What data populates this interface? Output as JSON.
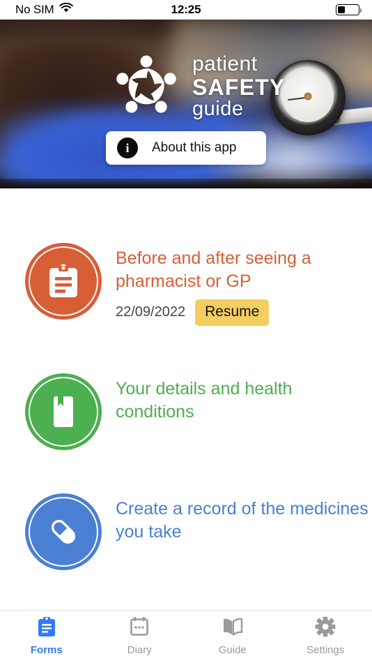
{
  "status_bar": {
    "carrier": "No SIM",
    "wifi_icon": "wifi-icon",
    "time": "12:25",
    "battery_icon": "battery-low-icon",
    "battery_level_pct": 35
  },
  "hero": {
    "logo": {
      "mark_icon": "patient-safety-circle-people-logo",
      "line1": "patient",
      "line2": "SAFETY",
      "line3": "guide"
    },
    "about_button": {
      "icon": "info-icon",
      "label": "About this app"
    },
    "photo_description_icons": [
      "blood-pressure-gauge",
      "patient-photo"
    ]
  },
  "cards": [
    {
      "icon": "clipboard-icon",
      "color": "#D85E36",
      "title": "Before and after seeing a pharmacist or GP",
      "date": "22/09/2022",
      "action_label": "Resume",
      "action_color": "#F4CE5E"
    },
    {
      "icon": "book-bookmark-icon",
      "color": "#4CAF50",
      "title": "Your details and health conditions",
      "date": null,
      "action_label": null,
      "action_color": null
    },
    {
      "icon": "pill-icon",
      "color": "#4A7FD4",
      "title": "Create a record of the medicines you take",
      "date": null,
      "action_label": null,
      "action_color": null
    }
  ],
  "tab_bar": {
    "active_color": "#2F7CF6",
    "idle_color": "#9A9A9A",
    "tabs": [
      {
        "icon": "clipboard-icon",
        "label": "Forms",
        "active": true
      },
      {
        "icon": "calendar-icon",
        "label": "Diary",
        "active": false
      },
      {
        "icon": "open-book-icon",
        "label": "Guide",
        "active": false
      },
      {
        "icon": "gear-icon",
        "label": "Settings",
        "active": false
      }
    ]
  }
}
